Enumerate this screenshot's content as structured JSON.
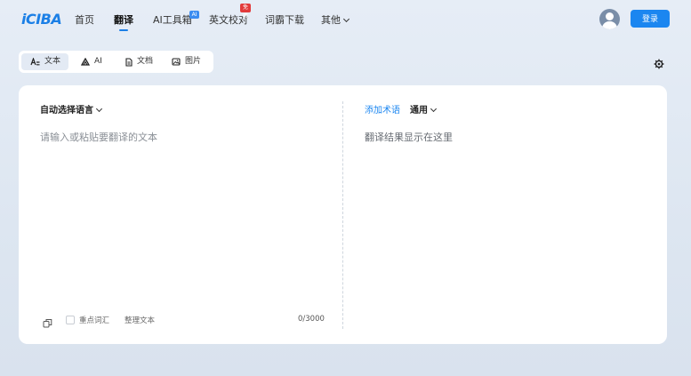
{
  "header": {
    "logo": "iCIBA",
    "nav": [
      {
        "label": "首页"
      },
      {
        "label": "翻译"
      },
      {
        "label": "AI工具箱"
      },
      {
        "label": "英文校对"
      },
      {
        "label": "词霸下载"
      },
      {
        "label": "其他"
      }
    ],
    "ai_badge": "AI",
    "free_badge": "免费",
    "login_label": "登录"
  },
  "mode_tabs": [
    {
      "label": "文本"
    },
    {
      "label": "AI"
    },
    {
      "label": "文档"
    },
    {
      "label": "图片"
    }
  ],
  "source": {
    "lang_label": "自动选择语言",
    "placeholder": "请输入或粘贴要翻译的文本",
    "keyword_label": "重点词汇",
    "tidy_label": "整理文本",
    "counter": "0/3000"
  },
  "target": {
    "term_label": "添加术语",
    "domain_label": "通用",
    "placeholder": "翻译结果显示在这里"
  },
  "colors": {
    "accent": "#1b86f0",
    "badge_red": "#e23b3b"
  }
}
